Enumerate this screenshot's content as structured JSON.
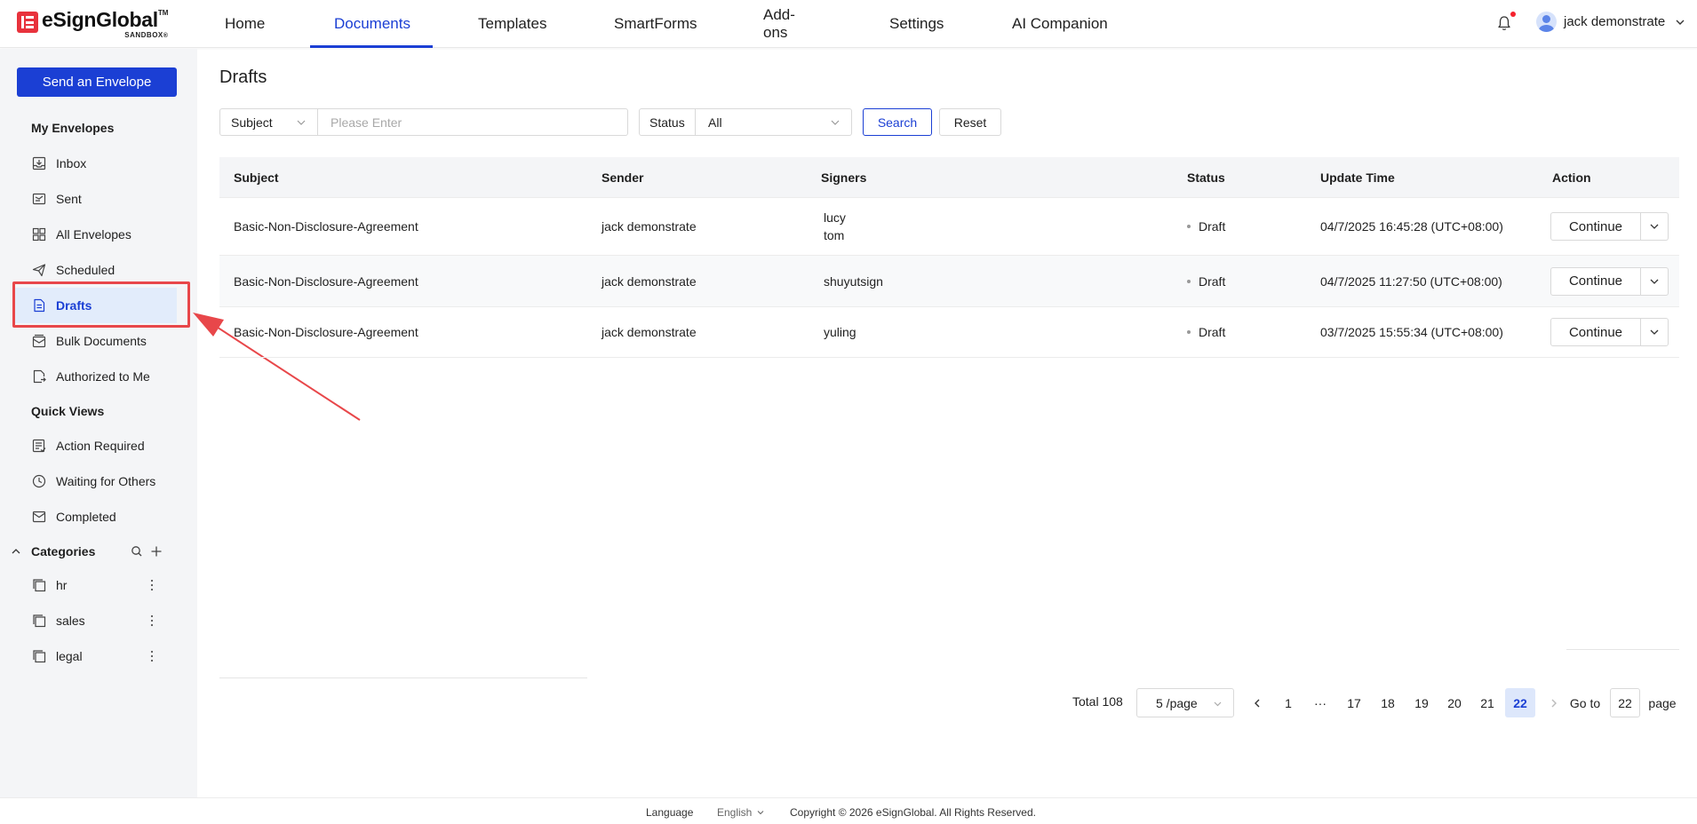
{
  "brand": {
    "name": "eSignGlobal",
    "tm": "TM",
    "env": "SANDBOX"
  },
  "nav": {
    "items": [
      {
        "label": "Home"
      },
      {
        "label": "Documents"
      },
      {
        "label": "Templates"
      },
      {
        "label": "SmartForms"
      },
      {
        "label": "Add-ons"
      },
      {
        "label": "Settings"
      },
      {
        "label": "AI Companion"
      }
    ],
    "active": "Documents"
  },
  "user": {
    "name": "jack demonstrate",
    "has_notification": true
  },
  "sidebar": {
    "send_button": "Send an Envelope",
    "my_envelopes_title": "My Envelopes",
    "my_envelopes": [
      {
        "label": "Inbox",
        "icon": "inbox-icon"
      },
      {
        "label": "Sent",
        "icon": "sent-icon"
      },
      {
        "label": "All Envelopes",
        "icon": "grid-icon"
      },
      {
        "label": "Scheduled",
        "icon": "scheduled-icon"
      },
      {
        "label": "Drafts",
        "icon": "draft-document-icon"
      },
      {
        "label": "Bulk Documents",
        "icon": "bulk-documents-icon"
      },
      {
        "label": "Authorized to Me",
        "icon": "authorized-icon"
      }
    ],
    "quick_views_title": "Quick Views",
    "quick_views": [
      {
        "label": "Action Required",
        "icon": "action-required-icon"
      },
      {
        "label": "Waiting for Others",
        "icon": "clock-icon"
      },
      {
        "label": "Completed",
        "icon": "completed-mail-icon"
      }
    ],
    "categories_title": "Categories",
    "categories": [
      {
        "label": "hr"
      },
      {
        "label": "sales"
      },
      {
        "label": "legal"
      }
    ]
  },
  "main": {
    "title": "Drafts",
    "filter": {
      "field": "Subject",
      "placeholder": "Please Enter",
      "status_label": "Status",
      "status_value": "All",
      "search_label": "Search",
      "reset_label": "Reset"
    },
    "table": {
      "headers": {
        "subject": "Subject",
        "sender": "Sender",
        "signers": "Signers",
        "status": "Status",
        "update_time": "Update Time",
        "action": "Action"
      },
      "rows": [
        {
          "subject": "Basic-Non-Disclosure-Agreement",
          "sender": "jack demonstrate",
          "signers": [
            "lucy",
            "tom"
          ],
          "status": "Draft",
          "update_time": "04/7/2025 16:45:28 (UTC+08:00)",
          "action": "Continue"
        },
        {
          "subject": "Basic-Non-Disclosure-Agreement",
          "sender": "jack demonstrate",
          "signers": [
            "shuyutsign"
          ],
          "status": "Draft",
          "update_time": "04/7/2025 11:27:50 (UTC+08:00)",
          "action": "Continue"
        },
        {
          "subject": "Basic-Non-Disclosure-Agreement",
          "sender": "jack demonstrate",
          "signers": [
            "yuling"
          ],
          "status": "Draft",
          "update_time": "03/7/2025 15:55:34 (UTC+08:00)",
          "action": "Continue"
        }
      ]
    },
    "pagination": {
      "total": "Total 108",
      "page_size": "5 /page",
      "pages": [
        "1",
        "···",
        "17",
        "18",
        "19",
        "20",
        "21",
        "22"
      ],
      "current": "22",
      "goto_label": "Go to",
      "goto_value": "22",
      "page_label": "page"
    }
  },
  "footer": {
    "language_label": "Language",
    "language_value": "English",
    "copyright": "Copyright © 2026 eSignGlobal. All Rights Reserved."
  },
  "colors": {
    "primary": "#1b3fd4",
    "annotation": "#e8474a",
    "sidebar_bg": "#f4f5f7",
    "active_bg": "#e2ecfb"
  }
}
